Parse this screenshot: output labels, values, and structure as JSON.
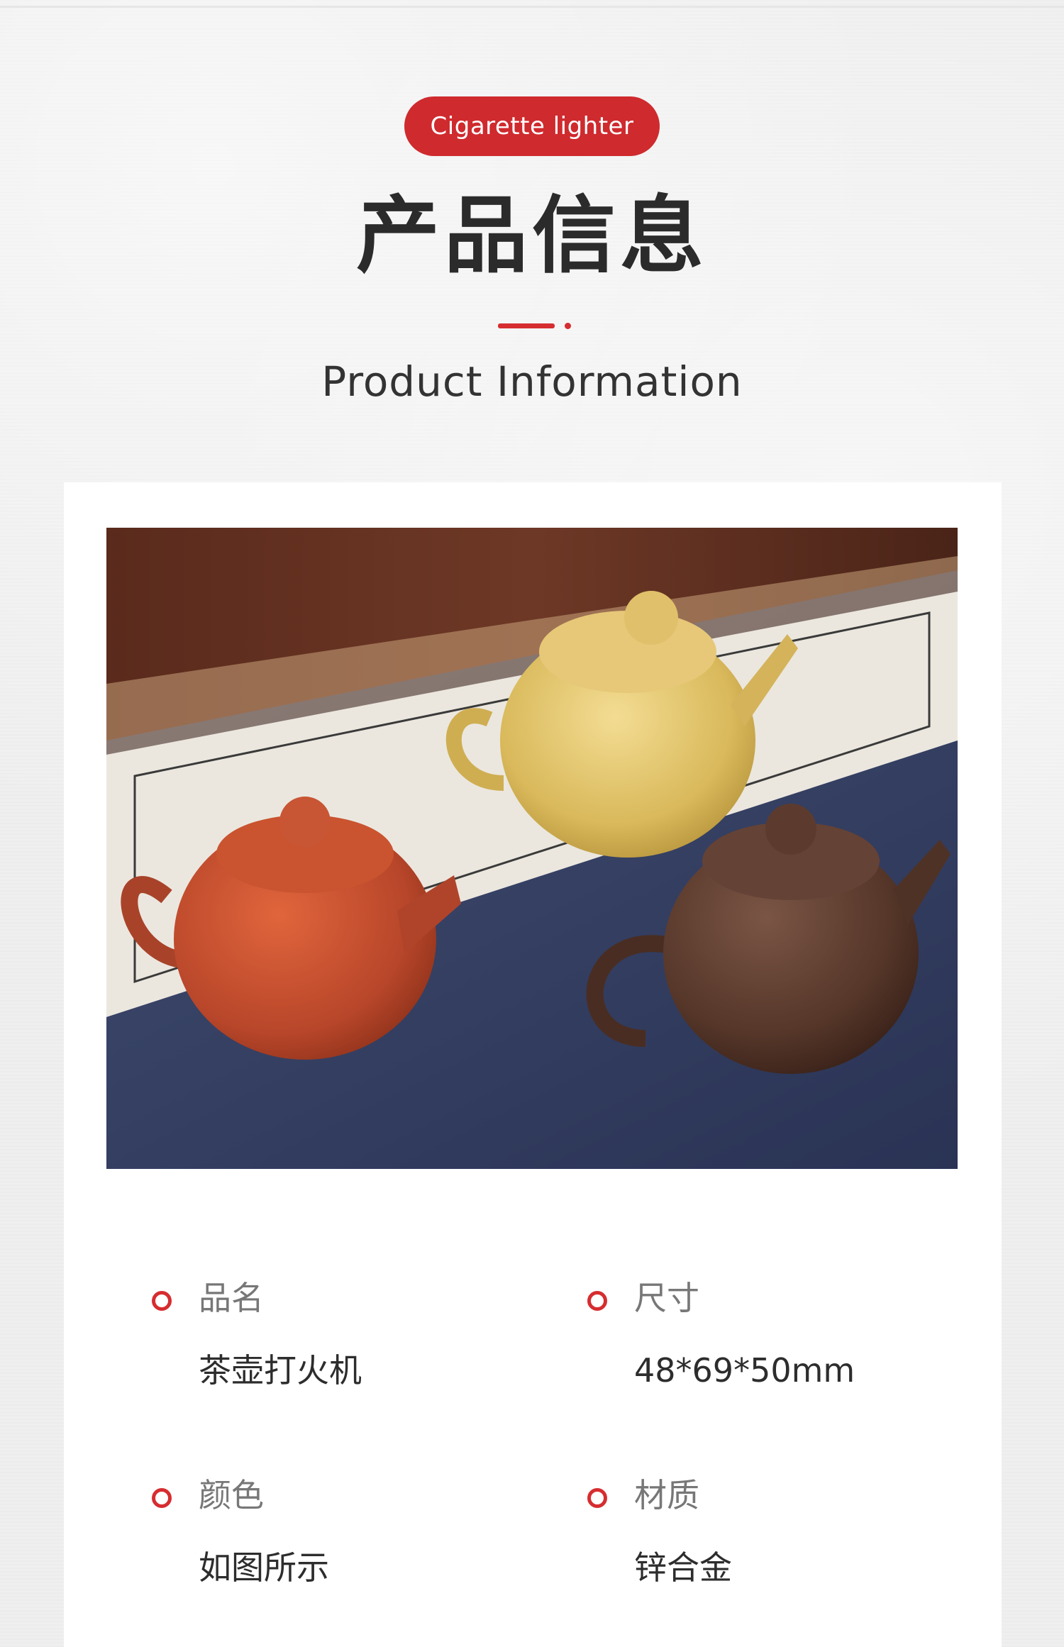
{
  "header": {
    "tag": "Cigarette lighter",
    "title_cn": "产品信息",
    "title_en": "Product Information"
  },
  "colors": {
    "accent": "#d62d30",
    "pill": "#cf2a2e",
    "card": "#ffffff",
    "page_bg": "#efefef"
  },
  "product_image": {
    "icon": "teapot-lighters-photo"
  },
  "specs": [
    {
      "label": "品名",
      "value": "茶壶打火机"
    },
    {
      "label": "尺寸",
      "value": "48*69*50mm"
    },
    {
      "label": "颜色",
      "value": "如图所示"
    },
    {
      "label": "材质",
      "value": "锌合金"
    }
  ]
}
